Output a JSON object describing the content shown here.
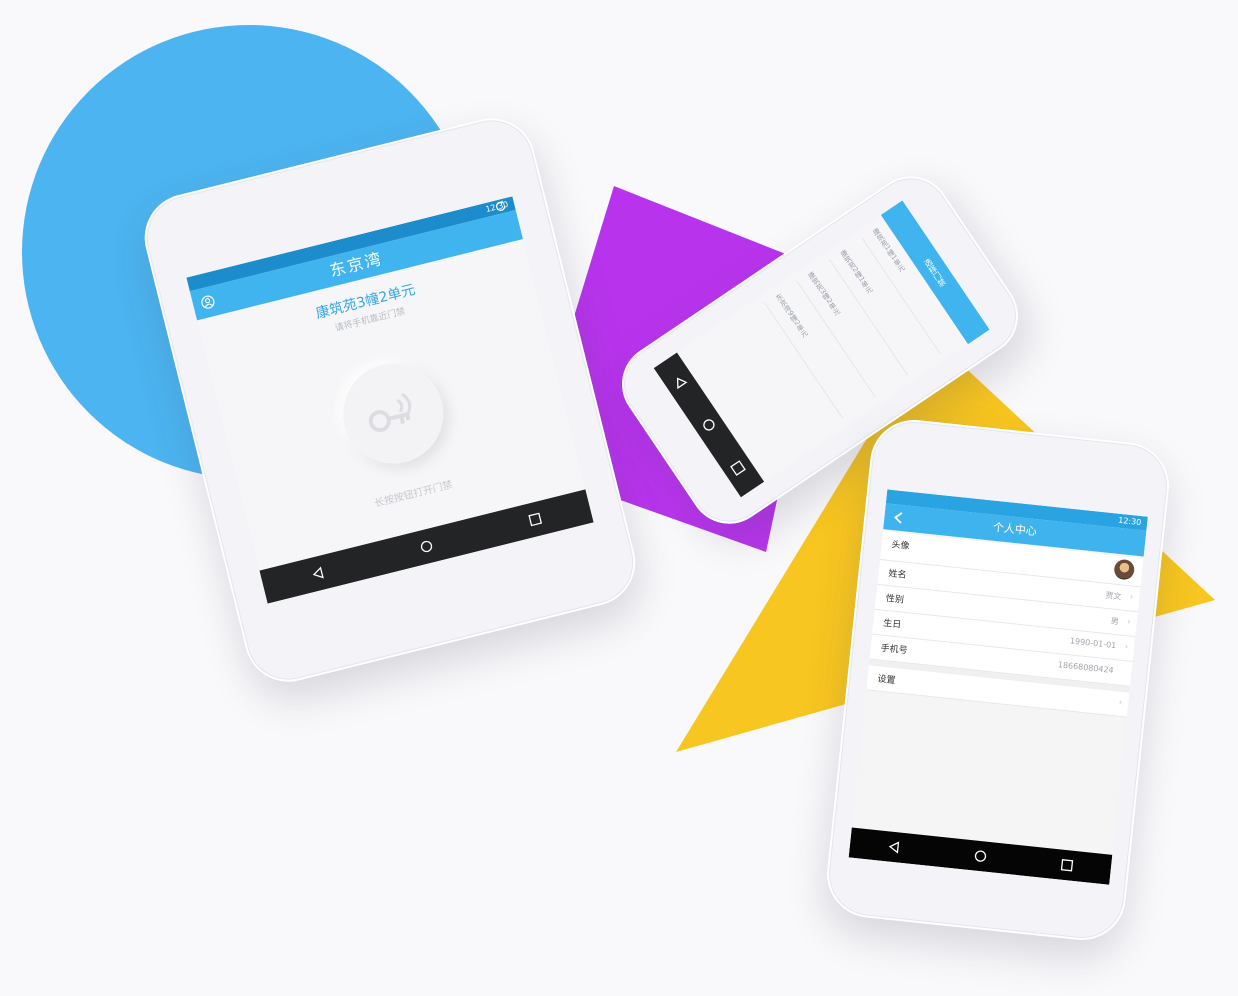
{
  "colors": {
    "blue_circle": "#4cb4f0",
    "purple": "#b834ec",
    "yellow": "#f8c620",
    "accent": "#40b4ee"
  },
  "phone1": {
    "status_time": "12:30",
    "app_title": "东京湾",
    "unit_name": "康筑苑3幢2单元",
    "unit_subtitle": "请将手机靠近门禁",
    "hint": "长按按钮打开门禁",
    "icons": [
      "user-icon",
      "refresh-icon",
      "key-signal-icon",
      "back-nav-icon",
      "home-nav-icon",
      "recents-nav-icon"
    ]
  },
  "phone2": {
    "header_title": "选择门禁",
    "list_items": [
      "康筑苑1幢1单元",
      "康筑苑2幢1单元",
      "康筑苑3幢2单元",
      "东京湾9幢2单元"
    ]
  },
  "phone3": {
    "status_time": "12:30",
    "title": "个人中心",
    "rows": [
      {
        "label": "头像",
        "value": ""
      },
      {
        "label": "姓名",
        "value": "贾文"
      },
      {
        "label": "性别",
        "value": "男"
      },
      {
        "label": "生日",
        "value": "1990-01-01"
      },
      {
        "label": "手机号",
        "value": "18668080424"
      },
      {
        "label": "设置",
        "value": ""
      }
    ]
  }
}
